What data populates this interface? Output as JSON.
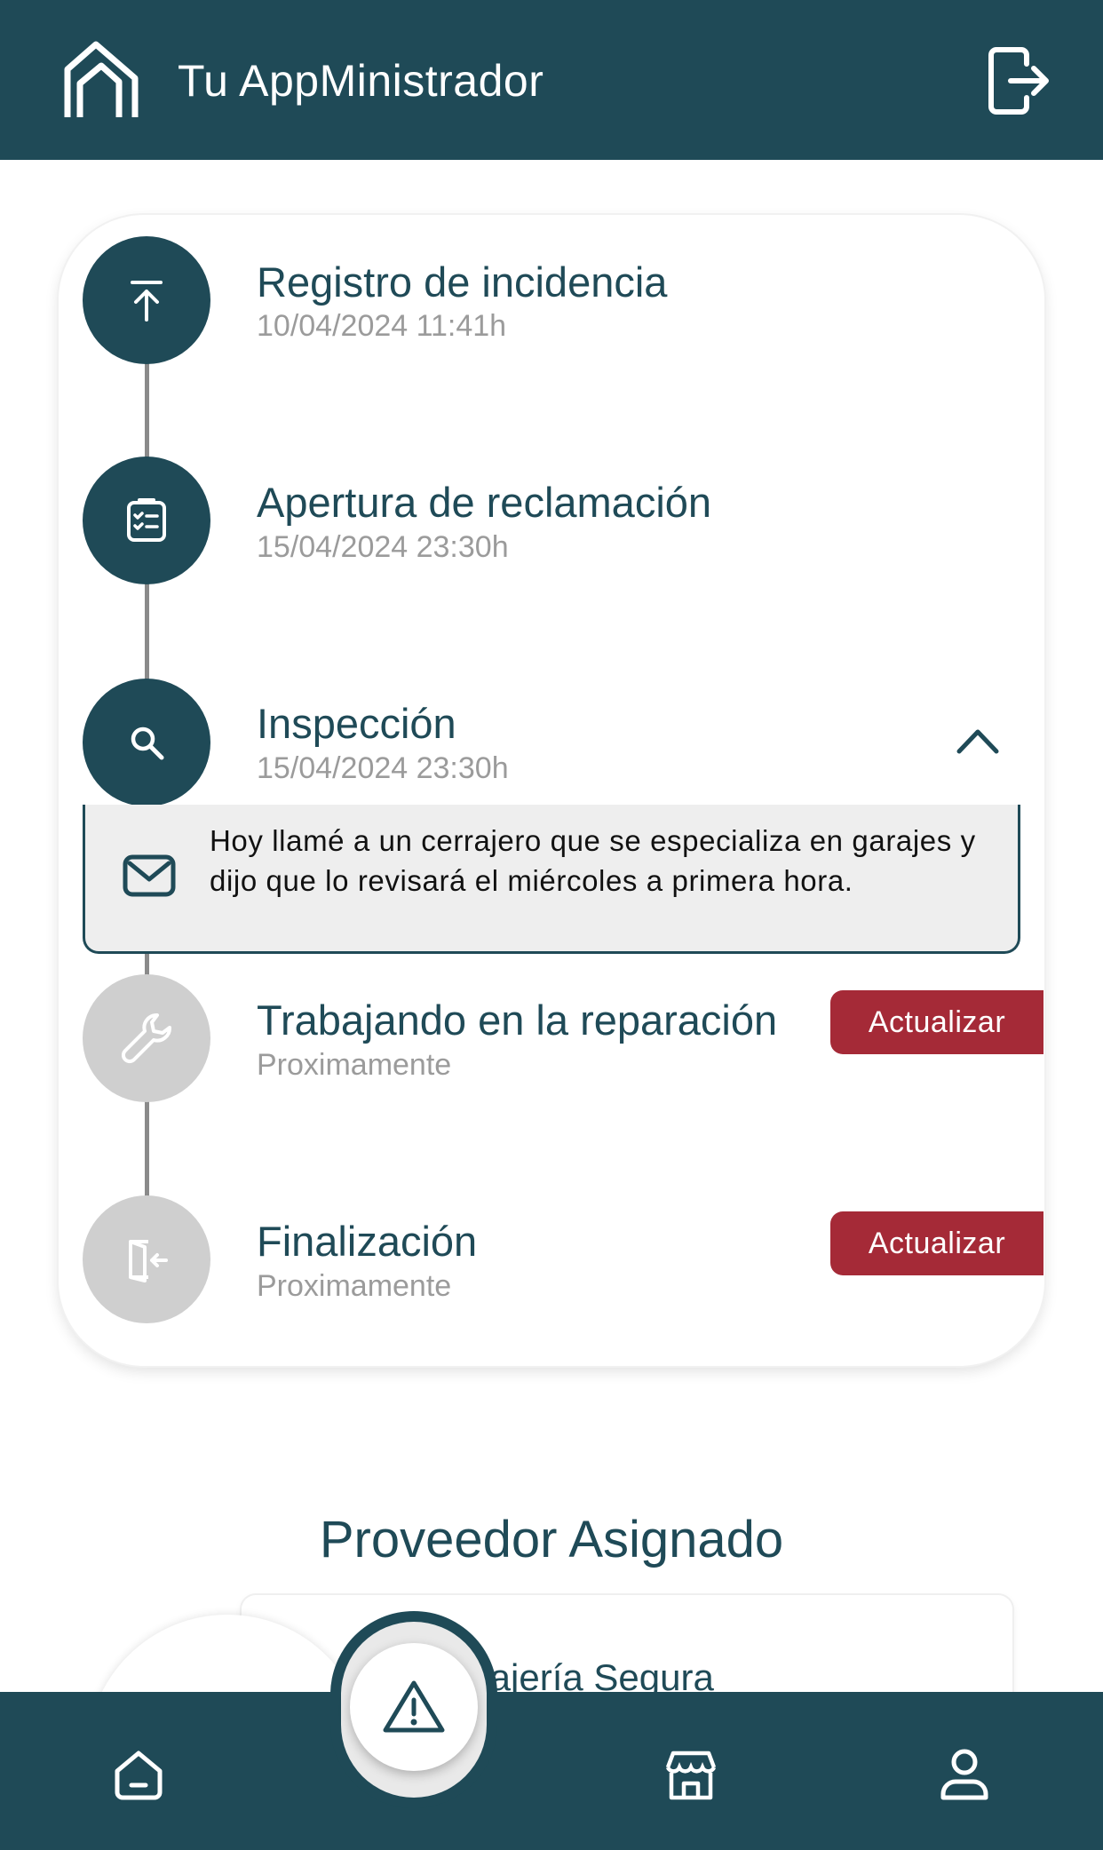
{
  "header": {
    "title": "Tu AppMinistrador",
    "logo_icon": "house-outline-logo-icon",
    "logout_icon": "logout-icon"
  },
  "timeline": {
    "steps": [
      {
        "title": "Registro de incidencia",
        "date": "10/04/2024 11:41h",
        "icon": "upload-icon",
        "state": "done"
      },
      {
        "title": "Apertura de reclamación",
        "date": "15/04/2024 23:30h",
        "icon": "checklist-icon",
        "state": "done"
      },
      {
        "title": "Inspección",
        "date": "15/04/2024 23:30h",
        "icon": "search-icon",
        "state": "expanded"
      },
      {
        "title": "Trabajando en la reparación",
        "date": "Proximamente",
        "icon": "wrench-icon",
        "state": "pending",
        "button": "Actualizar"
      },
      {
        "title": "Finalización",
        "date": "Proximamente",
        "icon": "exit-door-icon",
        "state": "pending",
        "button": "Actualizar"
      }
    ],
    "note": {
      "icon": "mail-icon",
      "text": "Hoy llamé a un cerrajero que se especializa en garajes y dijo que lo revisará el miércoles a primera hora."
    }
  },
  "provider": {
    "heading": "Proveedor Asignado",
    "name": "Cerrajería Segura"
  },
  "bottom_nav": {
    "items": [
      "home-icon",
      "alert-triangle-icon",
      "store-icon",
      "profile-icon"
    ]
  },
  "colors": {
    "primary": "#1f4a57",
    "accent_red": "#a52a37",
    "inactive": "#cfcfcf",
    "muted_text": "#9b9b9b"
  }
}
